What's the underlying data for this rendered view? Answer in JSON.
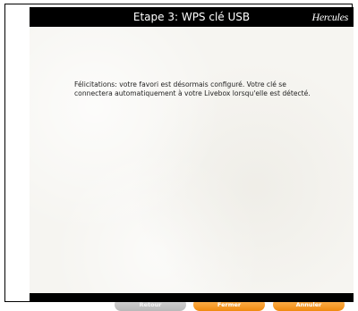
{
  "window": {
    "title": "Etape 3: WPS clé USB",
    "brand": "Hercules"
  },
  "content": {
    "message": "Félicitations: votre favori est désormais configuré. Votre clé se connectera automatiquement à votre Livebox lorsqu'elle est détecté."
  },
  "buttons": {
    "back_label": "Retour",
    "close_label": "Fermer",
    "cancel_label": "Annuler"
  },
  "colors": {
    "accent": "#f39a1f",
    "disabled": "#c8c8c8",
    "title_bar": "#000000"
  }
}
